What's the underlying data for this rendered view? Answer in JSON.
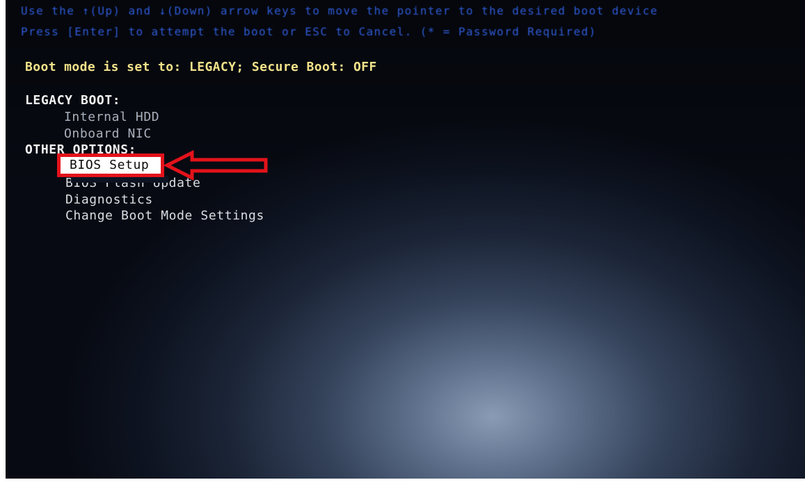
{
  "help_lines": [
    "Use the ↑(Up) and ↓(Down) arrow keys to move the pointer to the desired boot device",
    "Press [Enter] to attempt the boot or ESC to Cancel. (* = Password Required)"
  ],
  "boot_mode_line": "Boot mode is set to: LEGACY; Secure Boot: OFF",
  "legacy_boot": {
    "heading": "LEGACY BOOT:",
    "items": [
      "Internal HDD",
      "Onboard NIC"
    ]
  },
  "other_options": {
    "heading": "OTHER OPTIONS:",
    "items": [
      "BIOS Setup",
      "BIOS Flash Update",
      "Diagnostics",
      "Change Boot Mode Settings"
    ],
    "selected_index": 0
  },
  "annotation": {
    "box_color": "#e3121b",
    "arrow_color": "#e3121b",
    "arrow_icon": "left-arrow-icon"
  },
  "colors": {
    "help_text": "#2f5bd6",
    "mode_text": "#f2e28a",
    "menu_text": "#d9dde4"
  }
}
